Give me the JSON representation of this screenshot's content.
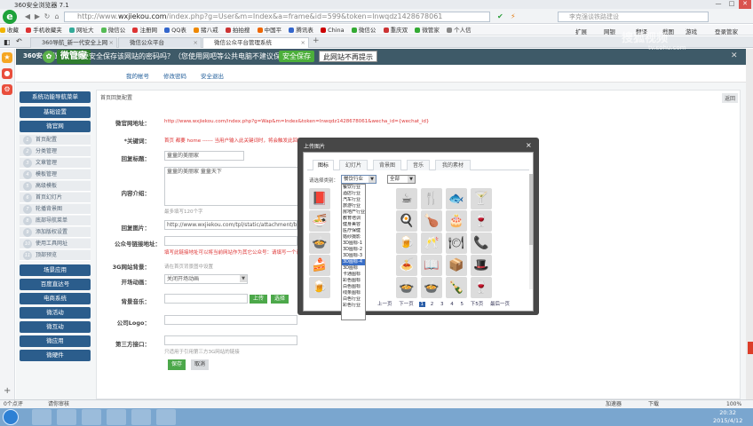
{
  "browser": {
    "title": "360安全浏览器 7.1",
    "url_prefix": "http://www.",
    "url_domain": "wxjiekou.com",
    "url_rest": "/index.php?g=User&m=Index&a=frame&id=599&token=lnwqdz1428678061",
    "search_placeholder": "李克强谈铁路建设",
    "menu": [
      "文件",
      "查看",
      "收藏",
      "工具",
      "帮助"
    ],
    "bookmarks": [
      "收藏",
      "手机收藏夹",
      "网址大",
      "微信公",
      "注册网",
      "QQ表",
      "猪八戒",
      "拍拍搜",
      "中国平",
      "腾讯表",
      "China",
      "微信公",
      "重庆双",
      "微管家",
      "个人信"
    ],
    "tools": [
      "扩展",
      "网银",
      "翻译",
      "截图",
      "游戏",
      "登录管家"
    ],
    "tabs": [
      {
        "label": "360导航_新一代安全上网"
      },
      {
        "label": "微信公众平台"
      },
      {
        "label": "微信公众平台管理系统"
      }
    ]
  },
  "site": {
    "brand_small": "360安全浏览",
    "brand_name": "微管家",
    "save_pw_text": "想要安全保存该网站的密码吗？（您使用网吧等公共电脑不建议保存）",
    "save_btn": "安全保存",
    "no_save_btn": "此网站不再提示",
    "subnav": [
      "我的帐号",
      "修改密码",
      "安全退出"
    ]
  },
  "sidebar": {
    "header": "系统功能导航菜单",
    "groups": [
      {
        "label": "基础设置"
      },
      {
        "label": "微官网"
      }
    ],
    "items": [
      "首页配置",
      "分类管理",
      "文章管理",
      "模板管理",
      "高级模板",
      "首页幻灯片",
      "轮播背景图",
      "底部导航菜单",
      "添加版权设置",
      "使用工具网址",
      "顶部预览"
    ],
    "bottom_groups": [
      "场景应用",
      "百度直达号",
      "电商系统",
      "微活动",
      "微互动",
      "微应用",
      "微硬件"
    ]
  },
  "main": {
    "breadcrumb": "首页回复配置",
    "back": "返回",
    "fields": {
      "site_url_label": "微官网地址：",
      "site_url_value": "http://www.wxjiekou.com/index.php?g=Wap&m=Index&token=lnwqdz1428678061&wecha_id={wechat_id}",
      "keyword_label": "*关键词：",
      "keyword_value": "首页 都要 home ------ 当用户输入此关键词时，将会触发此回复",
      "title_label": "回复标题：",
      "title_value": "童童的美丽家",
      "intro_label": "内容介绍：",
      "intro_value": "童童的美丽家 童童天下",
      "intro_hint": "最多填写120个字",
      "img_label": "回复图片：",
      "img_value": "http://www.wxjiekou.com/tpl/static/attachment/background/",
      "mp_label": "公众号链接地址：",
      "mp_hint": "填写此链接地址可以将当前网站作为其它公众号：请填写一个已关注的公众号",
      "bg_label": "3G网站背景：",
      "bg_hint": "请在首页背景图中设置",
      "anim_label": "开场动画：",
      "anim_value": "关闭开场动画",
      "music_label": "背景音乐：",
      "upload": "上传",
      "select": "选择",
      "logo_label": "公司Logo：",
      "iface_label": "第三方接口：",
      "iface_hint": "只适用于引用第三方3G网站的链接",
      "save": "保存",
      "cancel": "取消"
    }
  },
  "dialog": {
    "title": "上传图片",
    "tabs": [
      "图标",
      "幻灯片",
      "背景图",
      "音乐",
      "我的素材"
    ],
    "filter_label": "请选择类别：",
    "category": "餐饮行业",
    "subcategory": "全部",
    "options": [
      "餐饮行业",
      "酒店行业",
      "汽车行业",
      "旅游行业",
      "房地产行业",
      "教育培训",
      "健身美容",
      "医疗保健",
      "婚纱摄影",
      "3D图标-1",
      "3D图标-2",
      "3D图标-3",
      "3D图标-4",
      "3D图标",
      "卡通图标",
      "彩色图标",
      "白色图标",
      "线条图标",
      "白色行业",
      "彩色行业"
    ],
    "highlighted_index": 12,
    "icons": [
      "📕",
      "☕",
      "🍴",
      "🐟",
      "🍸",
      "🍜",
      "🍳",
      "🍗",
      "🎂",
      "🍷",
      "🍲",
      "🍺",
      "🥂",
      "🍽",
      "📞",
      "🍰",
      "🍝",
      "📖",
      "📦",
      "🎩",
      "🍺",
      "🍲",
      "🍲",
      "🍾",
      "🍷"
    ],
    "pager": {
      "prev": "上一页",
      "next": "下一页",
      "pages": [
        "1",
        "2",
        "3",
        "4",
        "5"
      ],
      "next2": "下5页",
      "last": "最后一页"
    }
  },
  "status": {
    "left": "0个点评",
    "mid": "请你审核",
    "accel": "加速器",
    "download": "下载",
    "zoom": "100%"
  },
  "taskbar": {
    "time": "20:32",
    "date": "2015/4/12"
  },
  "watermark": {
    "line1": "搜狐视频",
    "line2": "tv.sohu.com"
  }
}
